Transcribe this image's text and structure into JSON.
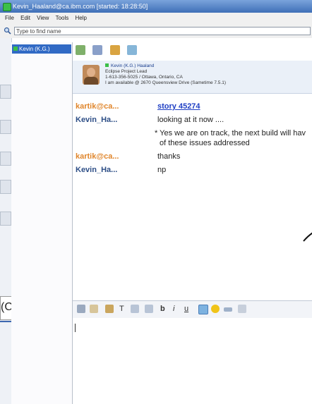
{
  "window": {
    "title": "Kevin_Haaland@ca.ibm.com [started: 18:28:50]"
  },
  "menu": [
    "File",
    "Edit",
    "View",
    "Tools",
    "Help"
  ],
  "search": {
    "placeholder": "Type to find name"
  },
  "contacts": [
    {
      "label": "Kevin (K.G.)",
      "status": "available"
    }
  ],
  "business_card": {
    "name": "Kevin (K.G.) Haaland",
    "title": "Eclipse Project Lead",
    "phone_location": "1-613-356-5025 / Ottawa, Ontario, CA",
    "status_line": "I am available @ 2670 Queensview Drive (Sametime 7.5.1)"
  },
  "transcript": [
    {
      "sender": "kartik@ca...",
      "text": "story 45274",
      "is_link": true
    },
    {
      "sender": "Kevin_Ha...",
      "text": "looking at it now ....",
      "is_link": false
    },
    {
      "sender": "",
      "text": "* Yes we are on track, the next build will hav",
      "is_link": false
    },
    {
      "sender": "",
      "text": "of these issues addressed",
      "is_link": false
    },
    {
      "sender": "kartik@ca...",
      "text": "thanks",
      "is_link": false
    },
    {
      "sender": "Kevin_Ha...",
      "text": "np",
      "is_link": false
    }
  ],
  "format_toolbar": {
    "font_button": "T",
    "bold": "b",
    "italic": "i",
    "underline": "u"
  },
  "left_fragment": "(C",
  "colors": {
    "title_bar": "#3f6fb7",
    "selected_contact": "#316ac5",
    "sender_other": "#e0862c",
    "sender_self": "#2d4e86",
    "link": "#1f3fc4",
    "online": "#3cbf48"
  }
}
